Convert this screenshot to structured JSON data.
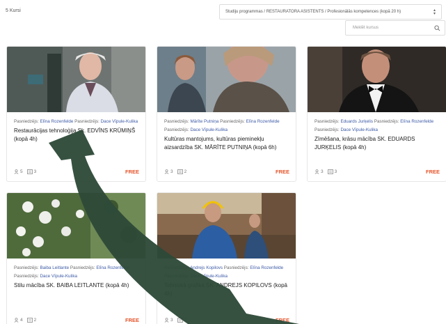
{
  "course_count": "5 Kursi",
  "filter": {
    "selected": "Studiju programmas / RESTAURATORA ASISTENTS / Profesionālās kompetences (kopā 20 h)"
  },
  "search": {
    "placeholder": "Meklēt kursus"
  },
  "meta_labels": {
    "teacher": "Pasniedzējs:"
  },
  "cards": [
    {
      "teachers": [
        "Elīna Rozenfelde",
        "Dace Vīpule-Kulika"
      ],
      "title": "Restaurācijas tehnoloģija Sk. EDVĪNS KRŪMIŅŠ (kopā 4h)",
      "students": "5",
      "lessons": "3",
      "price": "FREE"
    },
    {
      "teachers": [
        "Mārīte Putniņa",
        "Elīna Rozenfelde",
        "Dace Vīpule-Kulika"
      ],
      "title": "Kultūras mantojums, kultūras pieminekļu aizsardzība SK. MĀRĪTE PUTNIŅA (kopā 6h)",
      "students": "3",
      "lessons": "2",
      "price": "FREE"
    },
    {
      "teachers": [
        "Eduards Jurķelis",
        "Elīna Rozenfelde",
        "Dace Vīpule-Kulika"
      ],
      "title": "Zīmēšana, krāsu mācība SK. EDUARDS JURĶELIS (kopā 4h)",
      "students": "3",
      "lessons": "3",
      "price": "FREE"
    },
    {
      "teachers": [
        "Baiba Leitlante",
        "Elīna Rozenfelde",
        "Dace Vīpule-Kulika"
      ],
      "title": "Stilu mācība SK. BAIBA LEITLANTE (kopā 4h)",
      "students": "4",
      "lessons": "2",
      "price": "FREE"
    },
    {
      "teachers": [
        "Andrejs Kopilovs",
        "Elīna Rozenfelde",
        "Dace Vīpule-Kulika"
      ],
      "title": "Tehniskā grafika SK. ANDREJS KOPILOVS (kopā 4h)",
      "students": "3",
      "lessons": "2",
      "price": "FREE"
    }
  ],
  "colors": {
    "accent": "#e5542b",
    "link": "#3c5aa6",
    "arrow": "#2e4a38"
  }
}
